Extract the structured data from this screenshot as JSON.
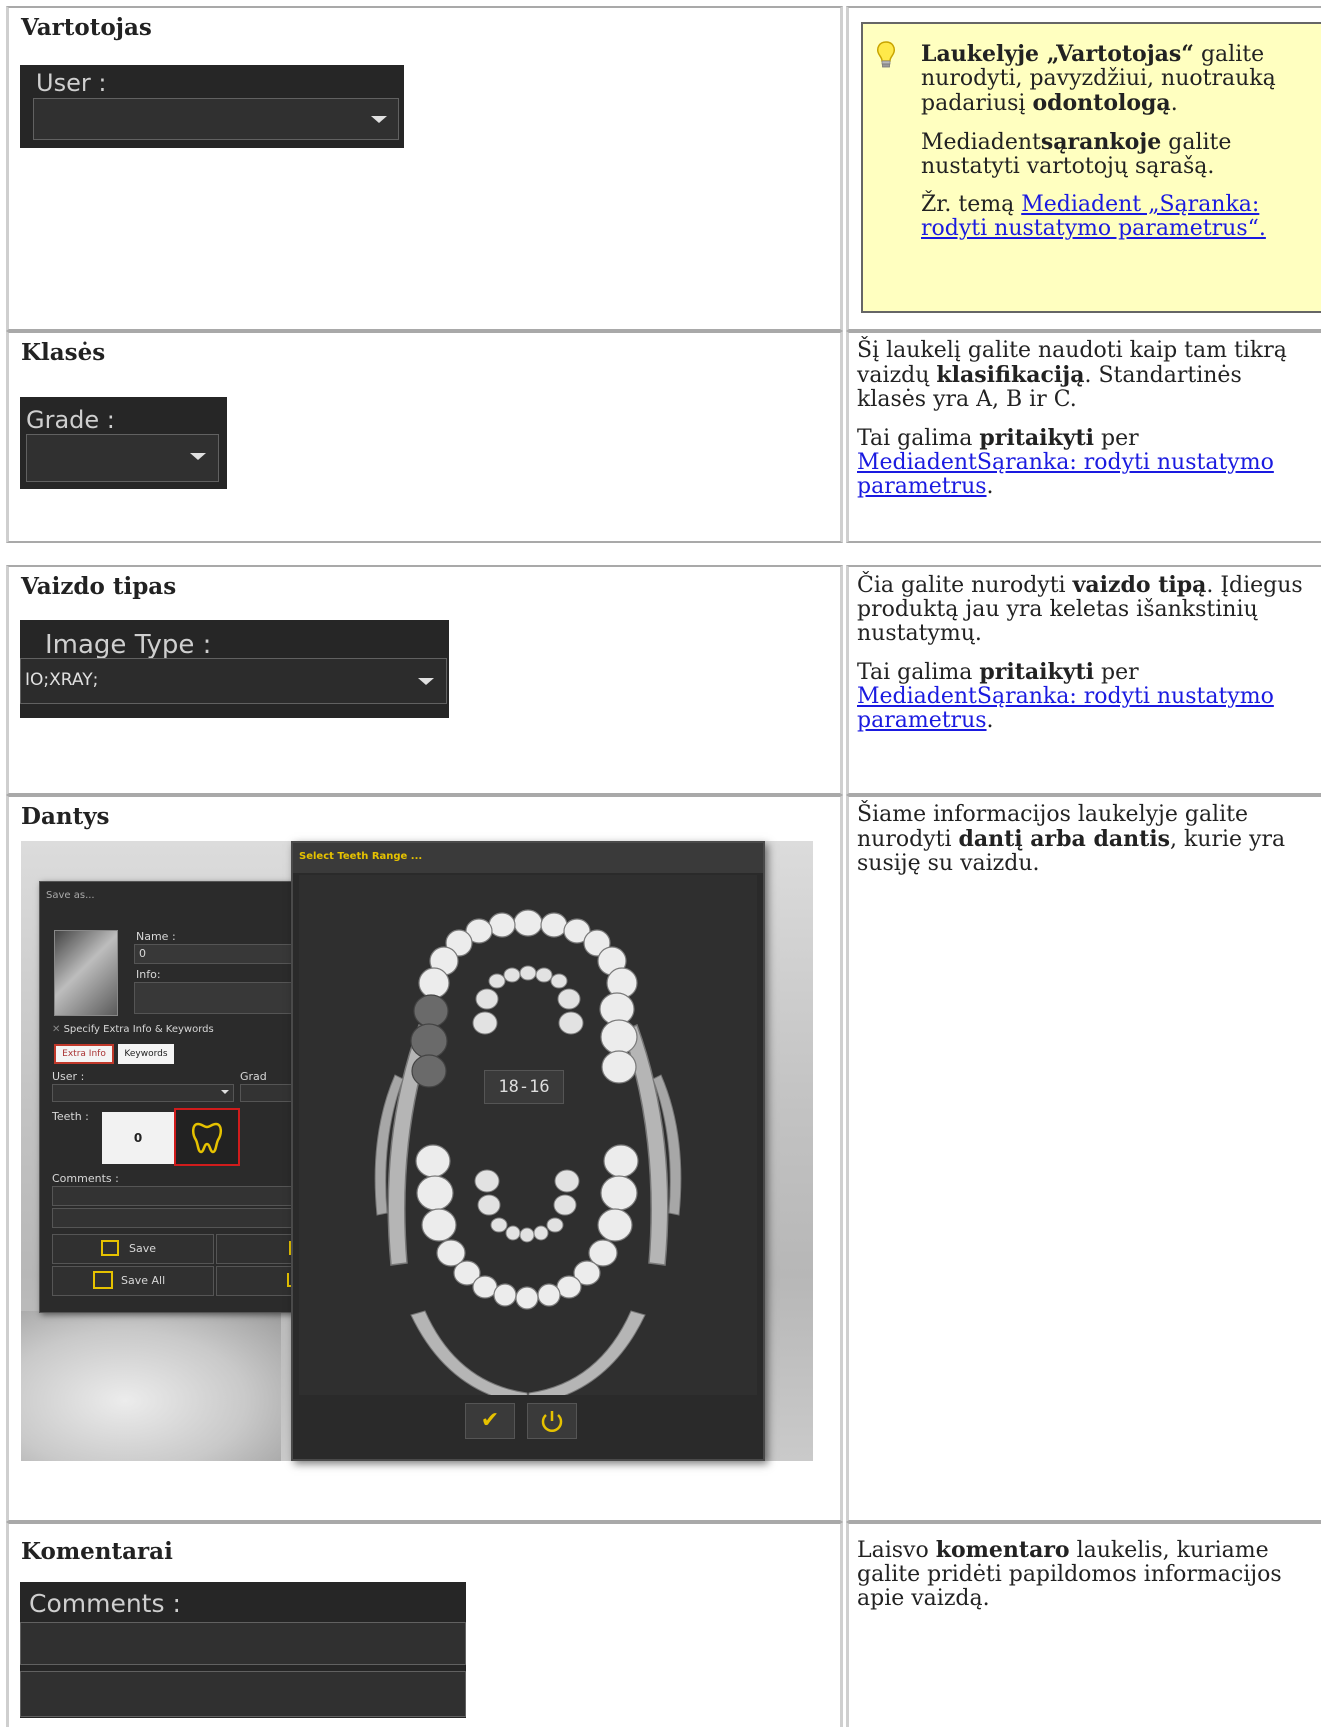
{
  "rows": [
    {
      "heading": "Vartotojas",
      "widget_label": "User :",
      "note": {
        "p1_bold": "Laukelyje „Vartotojas“",
        "p1_rest": " galite nurodyti, pavyzdžiui, nuotrauką padariusį ",
        "p1_bold2": "odontologą",
        "p1_end": ".",
        "p2_start": "Mediadent",
        "p2_bold": "sąrankoje",
        "p2_rest": " galite nustatyti vartotojų sąrašą.",
        "p3_start": "Žr. temą ",
        "p3_link": "Mediadent „Sąranka: rodyti nustatymo parametrus“."
      }
    },
    {
      "heading": "Klasės",
      "widget_label": "Grade :",
      "p1_start": "Šį laukelį galite naudoti kaip tam tikrą vaizdų ",
      "p1_bold": "klasifikaciją",
      "p1_rest": ". Standartinės klasės yra A, B ir C.",
      "p2_start": "Tai galima ",
      "p2_bold": "pritaikyti",
      "p2_mid": " per ",
      "p2_link": "MediadentSąranka: rodyti nustatymo parametrus",
      "p2_end": "."
    },
    {
      "heading": "Vaizdo tipas",
      "widget_label": "Image Type :",
      "widget_value": "IO;XRAY;",
      "p1_start": "Čia galite nurodyti ",
      "p1_bold": "vaizdo tipą",
      "p1_rest": ". Įdiegus produktą jau yra keletas išankstinių nustatymų.",
      "p2_start": "Tai galima ",
      "p2_bold": "pritaikyti",
      "p2_mid": " per ",
      "p2_link": "MediadentSąranka: rodyti nustatymo parametrus",
      "p2_end": "."
    },
    {
      "heading": "Dantys",
      "p1_start": "Šiame informacijos laukelyje galite nurodyti ",
      "p1_bold": "dantį arba dantis",
      "p1_rest": ", kurie yra susiję su vaizdu.",
      "shot": {
        "dialog_title": "Select Teeth Range ...",
        "save_as_title": "Save as...",
        "name_label": "Name :",
        "name_value": "0",
        "info_label": "Info:",
        "extra_toggle": "Specify Extra Info & Keywords",
        "tab_extra": "Extra Info",
        "tab_keywords": "Keywords",
        "user_label": "User :",
        "grade_label": "Grad",
        "teeth_label": "Teeth :",
        "teeth_value": "0",
        "comments_label": "Comments :",
        "save_btn": "Save",
        "save_all_btn": "Save All",
        "range_value": "18-16"
      }
    },
    {
      "heading": "Komentarai",
      "widget_label": "Comments :",
      "p1_start": "Laisvo ",
      "p1_bold": "komentaro",
      "p1_rest": " laukelis, kuriame galite pridėti papildomos informacijos apie vaizdą."
    }
  ]
}
